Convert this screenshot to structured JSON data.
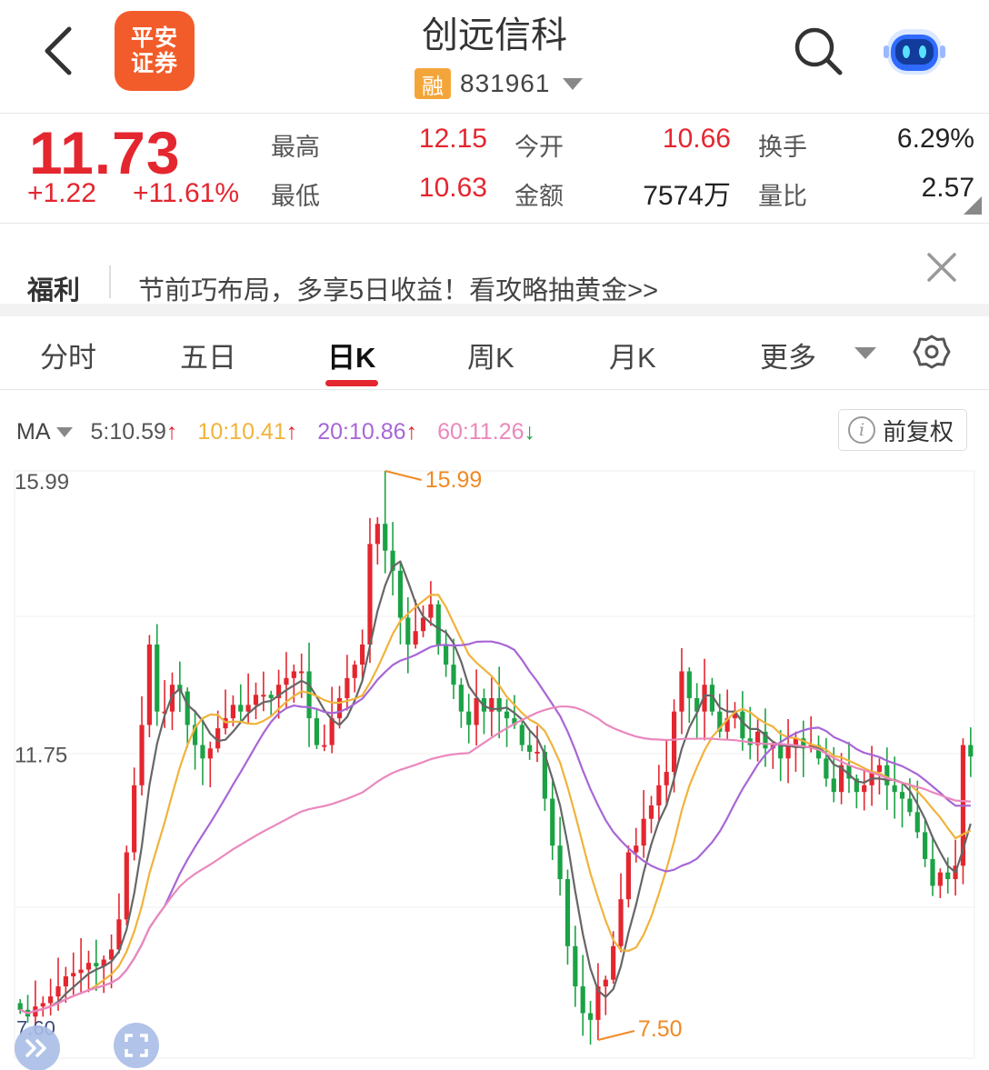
{
  "header": {
    "stock_name": "创远信科",
    "margin_badge": "融",
    "stock_code": "831961",
    "logo_text_line1": "平安",
    "logo_text_line2": "证券"
  },
  "quote": {
    "price": "11.73",
    "change": "+1.22",
    "change_pct": "+11.61%",
    "high_label": "最高",
    "high": "12.15",
    "low_label": "最低",
    "low": "10.63",
    "open_label": "今开",
    "open": "10.66",
    "amount_label": "金额",
    "amount": "7574万",
    "turnover_label": "换手",
    "turnover": "6.29%",
    "volume_ratio_label": "量比",
    "volume_ratio": "2.57"
  },
  "banner": {
    "tag": "福利",
    "text": "节前巧布局，多享5日收益！看攻略抽黄金>>"
  },
  "tabs": [
    {
      "label": "分时"
    },
    {
      "label": "五日"
    },
    {
      "label": "日K"
    },
    {
      "label": "周K"
    },
    {
      "label": "月K"
    },
    {
      "label": "更多"
    }
  ],
  "ma": {
    "label": "MA",
    "ma5": "5:10.59",
    "ma10": "10:10.41",
    "ma20": "20:10.86",
    "ma60": "60:11.26",
    "adjust": "前复权"
  },
  "colors": {
    "up": "#e4262f",
    "down": "#1ba245",
    "ma5": "#666666",
    "ma10": "#f0b33c",
    "ma20": "#a866d6",
    "ma60": "#ea88bd"
  },
  "chart_data": {
    "type": "candlestick",
    "ylim": [
      7.5,
      15.99
    ],
    "y_labels": [
      "15.99",
      "11.75"
    ],
    "max_marker": "15.99",
    "min_marker": "7.50",
    "start_marker": "7.60",
    "open": [
      8.05,
      7.95,
      7.85,
      8.0,
      8.05,
      8.15,
      8.3,
      8.45,
      8.5,
      8.55,
      8.65,
      8.6,
      8.7,
      8.85,
      9.3,
      10.3,
      11.3,
      12.2,
      13.4,
      12.4,
      12.4,
      12.8,
      12.7,
      12.2,
      11.9,
      11.7,
      11.85,
      12.15,
      12.3,
      12.5,
      12.4,
      12.5,
      12.65,
      12.65,
      12.6,
      12.8,
      12.9,
      13.0,
      13.0,
      12.3,
      11.9,
      11.9,
      12.3,
      12.6,
      12.9,
      13.1,
      13.4,
      14.9,
      15.2,
      14.8,
      14.5,
      13.8,
      13.4,
      13.6,
      13.8,
      14.0,
      13.4,
      13.1,
      12.8,
      12.4,
      12.2,
      12.6,
      12.4,
      12.6,
      12.4,
      12.3,
      12.2,
      11.9,
      11.8,
      11.8,
      11.1,
      10.4,
      9.9,
      8.9,
      8.3,
      7.9,
      7.8,
      8.3,
      8.4,
      8.9,
      9.6,
      10.3,
      10.4,
      10.8,
      11.0,
      11.3,
      11.5,
      12.4,
      13.0,
      12.6,
      12.4,
      12.8,
      12.4,
      12.1,
      12.3,
      12.4,
      12.0,
      11.9,
      12.1,
      11.85,
      11.9,
      11.7,
      11.9,
      12.0,
      11.85,
      11.9,
      11.7,
      11.4,
      11.2,
      11.6,
      11.4,
      11.2,
      11.3,
      11.5,
      11.6,
      11.3,
      11.2,
      11.1,
      10.9,
      10.6,
      10.2,
      9.8,
      10.0,
      9.9,
      10.1,
      11.9
    ],
    "close": [
      7.95,
      7.85,
      8.0,
      8.05,
      8.15,
      8.3,
      8.45,
      8.5,
      8.55,
      8.65,
      8.6,
      8.7,
      8.85,
      9.3,
      10.3,
      11.3,
      12.2,
      13.4,
      12.4,
      12.4,
      12.8,
      12.7,
      12.2,
      11.9,
      11.7,
      11.85,
      12.15,
      12.3,
      12.5,
      12.4,
      12.5,
      12.65,
      12.65,
      12.6,
      12.8,
      12.9,
      13.0,
      13.0,
      12.3,
      11.9,
      11.9,
      12.3,
      12.6,
      12.9,
      13.1,
      13.4,
      14.9,
      15.2,
      14.8,
      14.5,
      13.8,
      13.4,
      13.6,
      13.8,
      14.0,
      13.4,
      13.1,
      12.8,
      12.4,
      12.2,
      12.6,
      12.4,
      12.6,
      12.4,
      12.3,
      12.2,
      11.9,
      11.8,
      11.8,
      11.1,
      10.4,
      9.9,
      8.9,
      8.3,
      7.9,
      7.8,
      8.3,
      8.4,
      8.9,
      9.6,
      10.3,
      10.4,
      10.8,
      11.0,
      11.3,
      11.5,
      12.4,
      13.0,
      12.6,
      12.4,
      12.8,
      12.4,
      12.1,
      12.3,
      12.4,
      12.0,
      11.9,
      12.1,
      11.85,
      11.9,
      11.7,
      11.9,
      12.0,
      11.85,
      11.9,
      11.7,
      11.4,
      11.2,
      11.6,
      11.4,
      11.2,
      11.3,
      11.5,
      11.6,
      11.3,
      11.2,
      11.1,
      10.9,
      10.6,
      10.2,
      9.8,
      10.0,
      9.9,
      10.1,
      11.9,
      11.73
    ]
  }
}
